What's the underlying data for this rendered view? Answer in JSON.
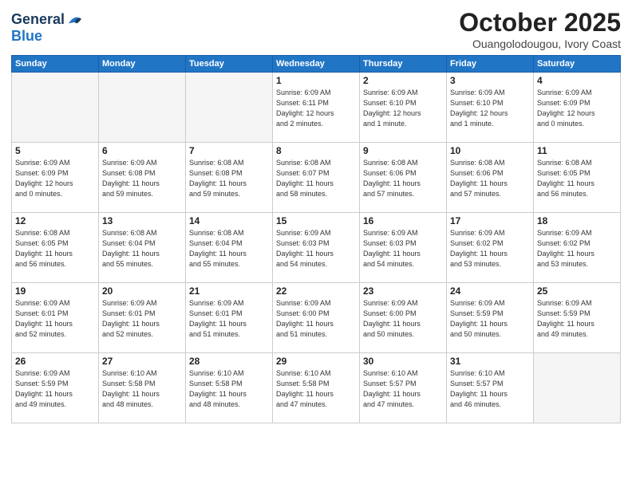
{
  "header": {
    "logo_line1": "General",
    "logo_line2": "Blue",
    "title": "October 2025",
    "location": "Ouangolodougou, Ivory Coast"
  },
  "weekdays": [
    "Sunday",
    "Monday",
    "Tuesday",
    "Wednesday",
    "Thursday",
    "Friday",
    "Saturday"
  ],
  "weeks": [
    [
      {
        "day": "",
        "info": ""
      },
      {
        "day": "",
        "info": ""
      },
      {
        "day": "",
        "info": ""
      },
      {
        "day": "1",
        "info": "Sunrise: 6:09 AM\nSunset: 6:11 PM\nDaylight: 12 hours\nand 2 minutes."
      },
      {
        "day": "2",
        "info": "Sunrise: 6:09 AM\nSunset: 6:10 PM\nDaylight: 12 hours\nand 1 minute."
      },
      {
        "day": "3",
        "info": "Sunrise: 6:09 AM\nSunset: 6:10 PM\nDaylight: 12 hours\nand 1 minute."
      },
      {
        "day": "4",
        "info": "Sunrise: 6:09 AM\nSunset: 6:09 PM\nDaylight: 12 hours\nand 0 minutes."
      }
    ],
    [
      {
        "day": "5",
        "info": "Sunrise: 6:09 AM\nSunset: 6:09 PM\nDaylight: 12 hours\nand 0 minutes."
      },
      {
        "day": "6",
        "info": "Sunrise: 6:09 AM\nSunset: 6:08 PM\nDaylight: 11 hours\nand 59 minutes."
      },
      {
        "day": "7",
        "info": "Sunrise: 6:08 AM\nSunset: 6:08 PM\nDaylight: 11 hours\nand 59 minutes."
      },
      {
        "day": "8",
        "info": "Sunrise: 6:08 AM\nSunset: 6:07 PM\nDaylight: 11 hours\nand 58 minutes."
      },
      {
        "day": "9",
        "info": "Sunrise: 6:08 AM\nSunset: 6:06 PM\nDaylight: 11 hours\nand 57 minutes."
      },
      {
        "day": "10",
        "info": "Sunrise: 6:08 AM\nSunset: 6:06 PM\nDaylight: 11 hours\nand 57 minutes."
      },
      {
        "day": "11",
        "info": "Sunrise: 6:08 AM\nSunset: 6:05 PM\nDaylight: 11 hours\nand 56 minutes."
      }
    ],
    [
      {
        "day": "12",
        "info": "Sunrise: 6:08 AM\nSunset: 6:05 PM\nDaylight: 11 hours\nand 56 minutes."
      },
      {
        "day": "13",
        "info": "Sunrise: 6:08 AM\nSunset: 6:04 PM\nDaylight: 11 hours\nand 55 minutes."
      },
      {
        "day": "14",
        "info": "Sunrise: 6:08 AM\nSunset: 6:04 PM\nDaylight: 11 hours\nand 55 minutes."
      },
      {
        "day": "15",
        "info": "Sunrise: 6:09 AM\nSunset: 6:03 PM\nDaylight: 11 hours\nand 54 minutes."
      },
      {
        "day": "16",
        "info": "Sunrise: 6:09 AM\nSunset: 6:03 PM\nDaylight: 11 hours\nand 54 minutes."
      },
      {
        "day": "17",
        "info": "Sunrise: 6:09 AM\nSunset: 6:02 PM\nDaylight: 11 hours\nand 53 minutes."
      },
      {
        "day": "18",
        "info": "Sunrise: 6:09 AM\nSunset: 6:02 PM\nDaylight: 11 hours\nand 53 minutes."
      }
    ],
    [
      {
        "day": "19",
        "info": "Sunrise: 6:09 AM\nSunset: 6:01 PM\nDaylight: 11 hours\nand 52 minutes."
      },
      {
        "day": "20",
        "info": "Sunrise: 6:09 AM\nSunset: 6:01 PM\nDaylight: 11 hours\nand 52 minutes."
      },
      {
        "day": "21",
        "info": "Sunrise: 6:09 AM\nSunset: 6:01 PM\nDaylight: 11 hours\nand 51 minutes."
      },
      {
        "day": "22",
        "info": "Sunrise: 6:09 AM\nSunset: 6:00 PM\nDaylight: 11 hours\nand 51 minutes."
      },
      {
        "day": "23",
        "info": "Sunrise: 6:09 AM\nSunset: 6:00 PM\nDaylight: 11 hours\nand 50 minutes."
      },
      {
        "day": "24",
        "info": "Sunrise: 6:09 AM\nSunset: 5:59 PM\nDaylight: 11 hours\nand 50 minutes."
      },
      {
        "day": "25",
        "info": "Sunrise: 6:09 AM\nSunset: 5:59 PM\nDaylight: 11 hours\nand 49 minutes."
      }
    ],
    [
      {
        "day": "26",
        "info": "Sunrise: 6:09 AM\nSunset: 5:59 PM\nDaylight: 11 hours\nand 49 minutes."
      },
      {
        "day": "27",
        "info": "Sunrise: 6:10 AM\nSunset: 5:58 PM\nDaylight: 11 hours\nand 48 minutes."
      },
      {
        "day": "28",
        "info": "Sunrise: 6:10 AM\nSunset: 5:58 PM\nDaylight: 11 hours\nand 48 minutes."
      },
      {
        "day": "29",
        "info": "Sunrise: 6:10 AM\nSunset: 5:58 PM\nDaylight: 11 hours\nand 47 minutes."
      },
      {
        "day": "30",
        "info": "Sunrise: 6:10 AM\nSunset: 5:57 PM\nDaylight: 11 hours\nand 47 minutes."
      },
      {
        "day": "31",
        "info": "Sunrise: 6:10 AM\nSunset: 5:57 PM\nDaylight: 11 hours\nand 46 minutes."
      },
      {
        "day": "",
        "info": ""
      }
    ]
  ]
}
